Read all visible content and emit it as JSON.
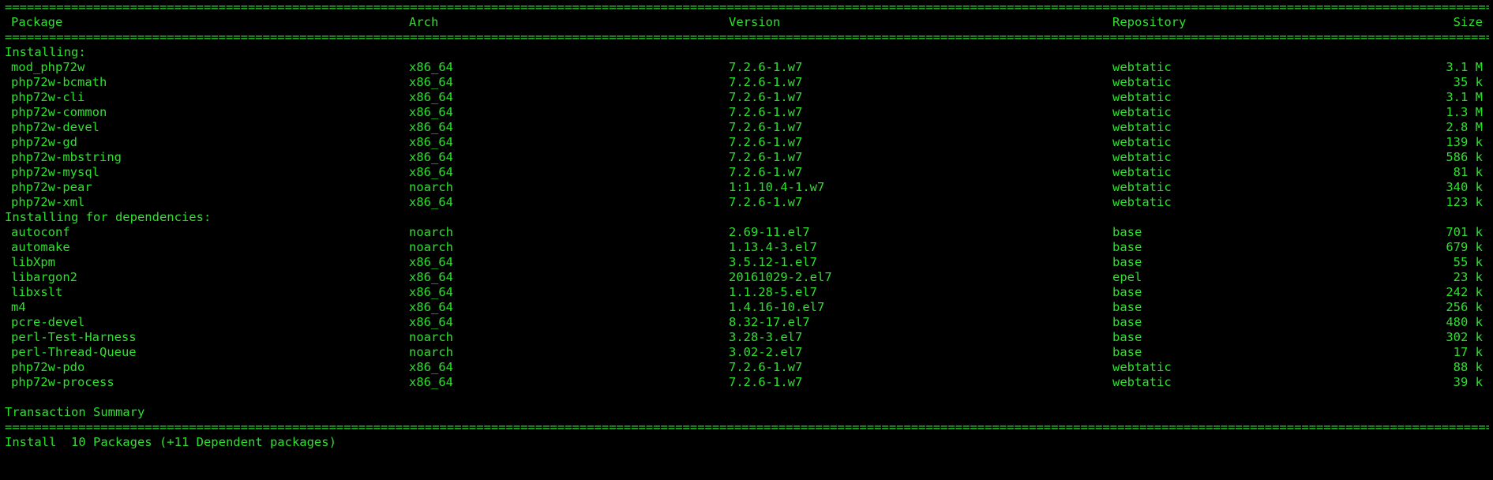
{
  "header": {
    "package": "Package",
    "arch": "Arch",
    "version": "Version",
    "repository": "Repository",
    "size": "Size"
  },
  "sections": [
    {
      "title": "Installing:",
      "rows": [
        {
          "package": "mod_php72w",
          "arch": "x86_64",
          "version": "7.2.6-1.w7",
          "repository": "webtatic",
          "size": "3.1 M"
        },
        {
          "package": "php72w-bcmath",
          "arch": "x86_64",
          "version": "7.2.6-1.w7",
          "repository": "webtatic",
          "size": "35 k"
        },
        {
          "package": "php72w-cli",
          "arch": "x86_64",
          "version": "7.2.6-1.w7",
          "repository": "webtatic",
          "size": "3.1 M"
        },
        {
          "package": "php72w-common",
          "arch": "x86_64",
          "version": "7.2.6-1.w7",
          "repository": "webtatic",
          "size": "1.3 M"
        },
        {
          "package": "php72w-devel",
          "arch": "x86_64",
          "version": "7.2.6-1.w7",
          "repository": "webtatic",
          "size": "2.8 M"
        },
        {
          "package": "php72w-gd",
          "arch": "x86_64",
          "version": "7.2.6-1.w7",
          "repository": "webtatic",
          "size": "139 k"
        },
        {
          "package": "php72w-mbstring",
          "arch": "x86_64",
          "version": "7.2.6-1.w7",
          "repository": "webtatic",
          "size": "586 k"
        },
        {
          "package": "php72w-mysql",
          "arch": "x86_64",
          "version": "7.2.6-1.w7",
          "repository": "webtatic",
          "size": "81 k"
        },
        {
          "package": "php72w-pear",
          "arch": "noarch",
          "version": "1:1.10.4-1.w7",
          "repository": "webtatic",
          "size": "340 k"
        },
        {
          "package": "php72w-xml",
          "arch": "x86_64",
          "version": "7.2.6-1.w7",
          "repository": "webtatic",
          "size": "123 k"
        }
      ]
    },
    {
      "title": "Installing for dependencies:",
      "rows": [
        {
          "package": "autoconf",
          "arch": "noarch",
          "version": "2.69-11.el7",
          "repository": "base",
          "size": "701 k"
        },
        {
          "package": "automake",
          "arch": "noarch",
          "version": "1.13.4-3.el7",
          "repository": "base",
          "size": "679 k"
        },
        {
          "package": "libXpm",
          "arch": "x86_64",
          "version": "3.5.12-1.el7",
          "repository": "base",
          "size": "55 k"
        },
        {
          "package": "libargon2",
          "arch": "x86_64",
          "version": "20161029-2.el7",
          "repository": "epel",
          "size": "23 k"
        },
        {
          "package": "libxslt",
          "arch": "x86_64",
          "version": "1.1.28-5.el7",
          "repository": "base",
          "size": "242 k"
        },
        {
          "package": "m4",
          "arch": "x86_64",
          "version": "1.4.16-10.el7",
          "repository": "base",
          "size": "256 k"
        },
        {
          "package": "pcre-devel",
          "arch": "x86_64",
          "version": "8.32-17.el7",
          "repository": "base",
          "size": "480 k"
        },
        {
          "package": "perl-Test-Harness",
          "arch": "noarch",
          "version": "3.28-3.el7",
          "repository": "base",
          "size": "302 k"
        },
        {
          "package": "perl-Thread-Queue",
          "arch": "noarch",
          "version": "3.02-2.el7",
          "repository": "base",
          "size": "17 k"
        },
        {
          "package": "php72w-pdo",
          "arch": "x86_64",
          "version": "7.2.6-1.w7",
          "repository": "webtatic",
          "size": "88 k"
        },
        {
          "package": "php72w-process",
          "arch": "x86_64",
          "version": "7.2.6-1.w7",
          "repository": "webtatic",
          "size": "39 k"
        }
      ]
    }
  ],
  "summary": {
    "title": "Transaction Summary",
    "install_line": "Install  10 Packages (+11 Dependent packages)"
  },
  "colors": {
    "background": "#000000",
    "text": "#2ee02e"
  }
}
